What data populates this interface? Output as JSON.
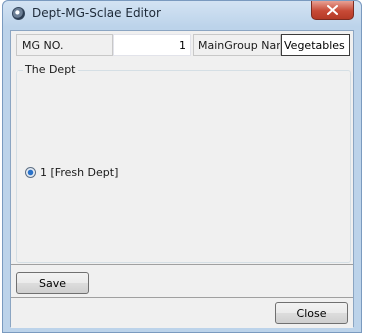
{
  "window": {
    "title": "Dept-MG-Sclae Editor",
    "app_icon": "app-globe-icon",
    "close_icon": "close-x-icon"
  },
  "form": {
    "mg_no_label": "MG NO.",
    "mg_no_value": "1",
    "main_group_label": "MainGroup Nam",
    "main_group_value": "Vegetables"
  },
  "dept_group": {
    "title": "The Dept",
    "options": [
      {
        "label": "1 [Fresh Dept]",
        "selected": true
      }
    ]
  },
  "buttons": {
    "save": "Save",
    "close": "Close"
  },
  "colors": {
    "title_bar": "#bcd3ea",
    "close_button": "#c74a36",
    "client_background": "#f0f0f0"
  }
}
